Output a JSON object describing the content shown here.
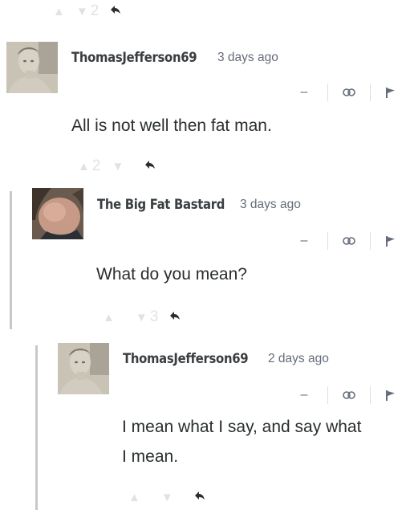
{
  "top_vote": {
    "up": "▲",
    "down": "▼",
    "count": "2",
    "reply_icon": "reply-arrow"
  },
  "comments": [
    {
      "author": "ThomasJefferson69",
      "time": "3 days ago",
      "text": "All is not well then fat man.",
      "votes": {
        "count_up": "2",
        "count_down": ""
      },
      "actions": {
        "collapse": "–"
      }
    },
    {
      "author": "The Big Fat Bastard",
      "time": "3 days ago",
      "text": "What do you mean?",
      "votes": {
        "count_up": "",
        "count_down": "3"
      },
      "actions": {
        "collapse": "–"
      }
    },
    {
      "author": "ThomasJefferson69",
      "time": "2 days ago",
      "text_line1": "I mean what I say, and say what",
      "text_line2": "I mean.",
      "votes": {
        "count_up": "",
        "count_down": ""
      },
      "actions": {
        "collapse": "–"
      }
    }
  ],
  "colors": {
    "vote_gray": "#dfe3e6",
    "text": "#2a2e2e",
    "meta": "#656c7a",
    "thread_line": "#c6c9cc"
  },
  "icons": [
    "upvote-icon",
    "downvote-icon",
    "reply-icon",
    "link-icon",
    "flag-icon"
  ]
}
